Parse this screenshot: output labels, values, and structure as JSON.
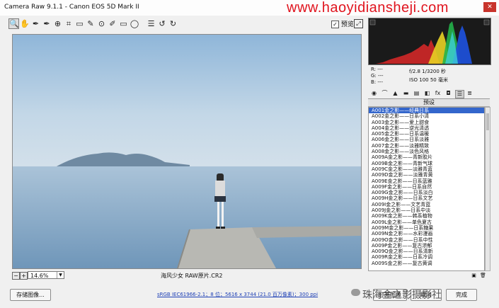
{
  "window": {
    "title": "Camera Raw 9.1.1 - Canon EOS 5D Mark II",
    "watermark": "www.haoyidiansheji.com",
    "close_glyph": "✕"
  },
  "toolbar": {
    "tools": [
      {
        "icon": "zoom-icon",
        "glyph": "🔍"
      },
      {
        "icon": "hand-icon",
        "glyph": "✋"
      },
      {
        "icon": "white-balance-icon",
        "glyph": "✒"
      },
      {
        "icon": "color-sampler-icon",
        "glyph": "✒"
      },
      {
        "icon": "targeted-adjustment-icon",
        "glyph": "⊕"
      },
      {
        "icon": "crop-icon",
        "glyph": "⌗"
      },
      {
        "icon": "straighten-icon",
        "glyph": "▭"
      },
      {
        "icon": "spot-removal-icon",
        "glyph": "✎"
      },
      {
        "icon": "red-eye-icon",
        "glyph": "⊙"
      },
      {
        "icon": "adjustment-brush-icon",
        "glyph": "✐"
      },
      {
        "icon": "graduated-filter-icon",
        "glyph": "▭"
      },
      {
        "icon": "radial-filter-icon",
        "glyph": "◯"
      },
      {
        "icon": "preferences-icon",
        "glyph": "☰"
      },
      {
        "icon": "rotate-left-icon",
        "glyph": "↺"
      },
      {
        "icon": "rotate-right-icon",
        "glyph": "↻"
      }
    ],
    "preview_label": "预览",
    "preview_checked": "✓",
    "fullscreen_glyph": "⤢"
  },
  "readout": {
    "r": "R:  ---",
    "g": "G:  ---",
    "b": "B:  ---",
    "exif_line1": "f/2.8   1/3200 秒",
    "exif_line2": "ISO 100   50 毫米"
  },
  "panel": {
    "header": "预设",
    "tabs": [
      "◉",
      "⌒",
      "▲",
      "▬",
      "▤",
      "◧",
      "fx",
      "◘",
      "☰",
      "≣"
    ],
    "presets": [
      "A001金之影——经典日系",
      "A002金之影——日系小清",
      "A003金之影——爱上甜食",
      "A004金之影——逆光清透",
      "A005金之影——日系温暖",
      "A006金之影——日系淡雅",
      "A007金之影——淡雅精致",
      "A008金之影——淡色风格",
      "A009A金之影——青新胶片",
      "A009B金之影——青新气球",
      "A009C金之影——淡雅青蓝",
      "A009D金之影——淡雅青黄",
      "A009E金之影——日系蓝雅",
      "A009F金之影——日系自然",
      "A009G金之影——日系淡白",
      "A009H金之影——日系文艺",
      "A009I金之影——文艺青蓝",
      "A009J金之影——日系中淡",
      "A009K金之影——韩系植物",
      "A009L金之影——单色夏古",
      "A009M金之影——日系糖果",
      "A009N金之影——水彩漫画",
      "A009O金之影——日系中性",
      "A009P金之影——复古浓郁",
      "A009Q金之影——日系清新",
      "A009R金之影——日系冷调",
      "A009S金之影——复古黄调"
    ],
    "footer_icons": [
      "▣",
      "🗑"
    ]
  },
  "zoom": {
    "minus": "−",
    "plus": "+",
    "value": "14.6%",
    "file_label": "海风少女 RAW原片.CR2"
  },
  "bottom": {
    "save_image": "存储图像...",
    "workflow": "sRGB IEC61966-2.1；8 位；5616 x 3744 (21.0 百万像素)；300 ppi",
    "open_image": "打开图像",
    "cancel": "取消",
    "done": "完成",
    "brand": "珠海金之影摄影社"
  }
}
